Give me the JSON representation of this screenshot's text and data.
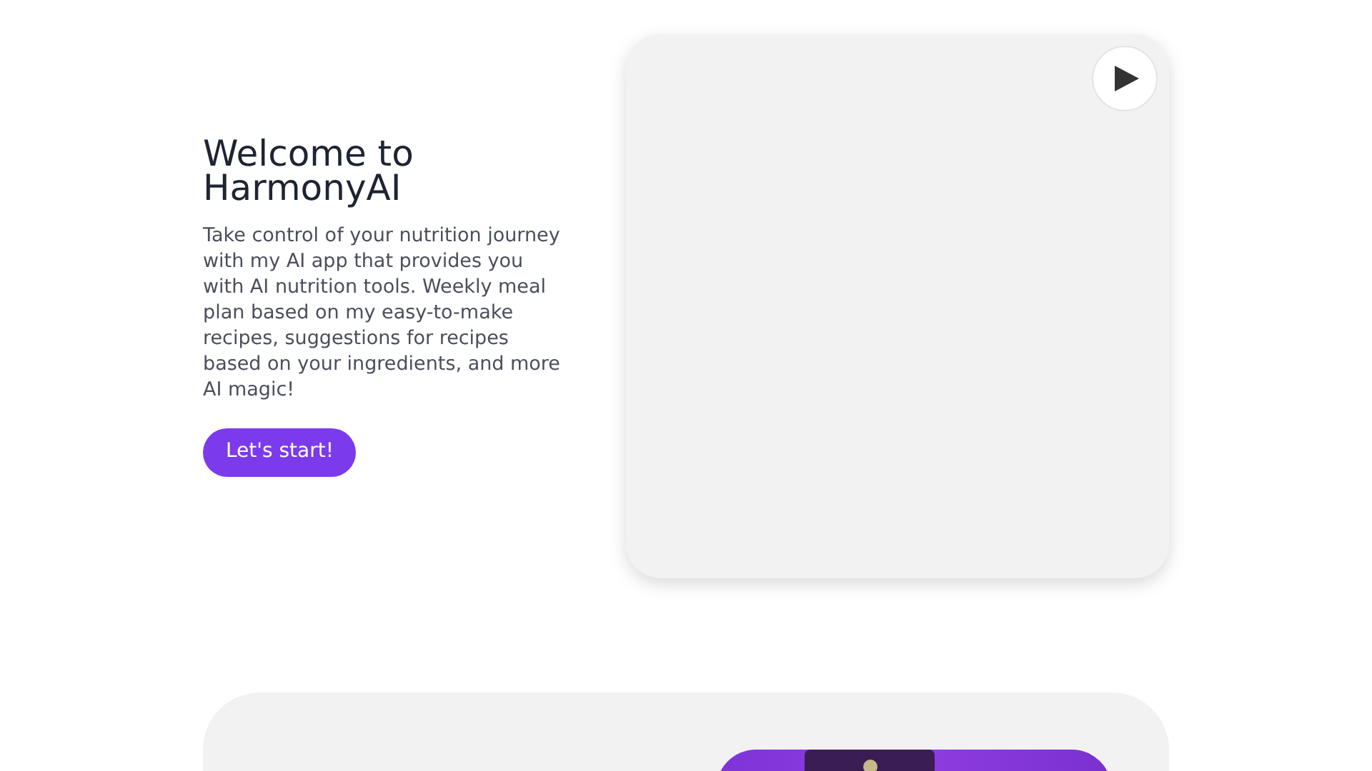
{
  "hero": {
    "title": "Welcome to HarmonyAI",
    "description": "Take control of your nutrition journey with my AI app that provides you with AI nutrition tools. Weekly meal plan based on my easy-to-make recipes, suggestions for recipes based on your ingredients, and more AI magic!",
    "button": "Let's start!"
  },
  "video": {
    "playing": false
  }
}
